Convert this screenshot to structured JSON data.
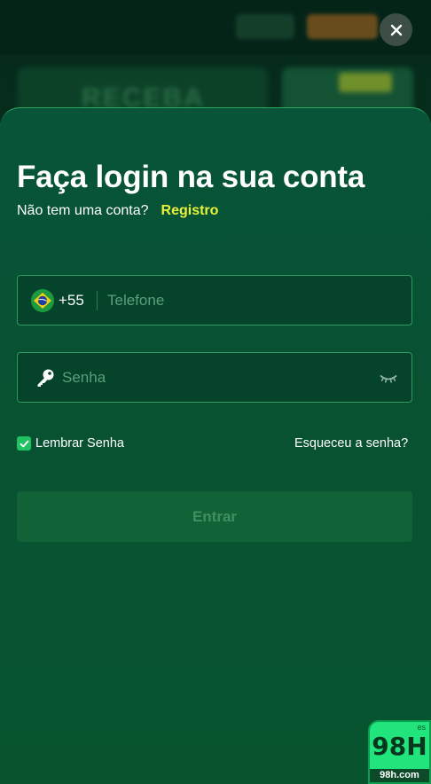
{
  "background": {
    "banner_text": "RECEBA"
  },
  "login": {
    "title": "Faça login na sua conta",
    "subtitle_prefix": "Não tem uma conta?",
    "register_link": "Registro",
    "phone": {
      "country_code": "+55",
      "placeholder": "Telefone",
      "value": ""
    },
    "password": {
      "placeholder": "Senha",
      "value": ""
    },
    "remember_label": "Lembrar Senha",
    "remember_checked": true,
    "forgot_link": "Esqueceu a senha?",
    "submit_label": "Entrar"
  },
  "brand": {
    "logo": "98H",
    "site": "98h.com",
    "tag": "es"
  },
  "colors": {
    "accent_link": "#e9f23b",
    "field_border": "#2e9b5f",
    "checkbox": "#1fc163",
    "badge": "#21e57c"
  },
  "icons": {
    "close": "close-icon",
    "flag": "brazil-flag-icon",
    "password": "key-icon",
    "toggle_visibility": "eye-closed-icon",
    "checkbox": "check-icon"
  }
}
